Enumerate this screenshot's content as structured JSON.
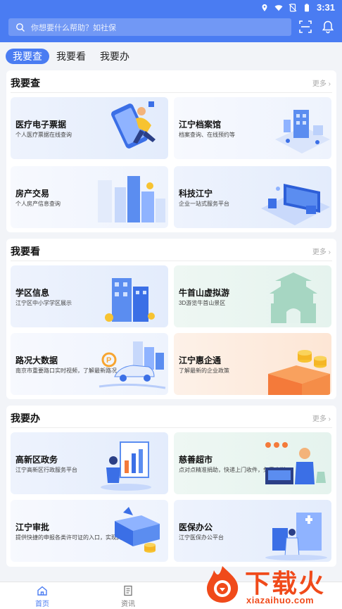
{
  "status_bar": {
    "time": "3:31",
    "icons": [
      "location-icon",
      "wifi-icon",
      "no-sim-icon",
      "battery-icon"
    ]
  },
  "header": {
    "search_placeholder": "你想要什么帮助？如社保",
    "scan_icon": "scan-icon",
    "bell_icon": "bell-icon"
  },
  "tabs": [
    {
      "label": "我要查",
      "active": true
    },
    {
      "label": "我要看",
      "active": false
    },
    {
      "label": "我要办",
      "active": false
    }
  ],
  "sections": [
    {
      "title": "我要查",
      "more": "更多",
      "cards": [
        {
          "title": "医疗电子票据",
          "subtitle": "个人医疗票据在线查询"
        },
        {
          "title": "江宁档案馆",
          "subtitle": "档案查询、在线预约等"
        },
        {
          "title": "房产交易",
          "subtitle": "个人房产信息查询"
        },
        {
          "title": "科技江宁",
          "subtitle": "企业一站式服务平台"
        }
      ]
    },
    {
      "title": "我要看",
      "more": "更多",
      "cards": [
        {
          "title": "学区信息",
          "subtitle": "江宁区中小学学区展示"
        },
        {
          "title": "牛首山虚拟游",
          "subtitle": "3D游览牛首山景区"
        },
        {
          "title": "路况大数据",
          "subtitle": "南京市重要路口实时视频，了解最新路况"
        },
        {
          "title": "江宁惠企通",
          "subtitle": "了解最新的企业政策"
        }
      ]
    },
    {
      "title": "我要办",
      "more": "更多",
      "cards": [
        {
          "title": "高新区政务",
          "subtitle": "江宁高新区行政服务平台"
        },
        {
          "title": "慈善超市",
          "subtitle": "点对点精准捐助，快递上门收件，免费寄送"
        },
        {
          "title": "江宁审批",
          "subtitle": "提供快捷的申报各类许可证的入口，实现网上申报"
        },
        {
          "title": "医保办公",
          "subtitle": "江宁医保办公平台"
        }
      ]
    }
  ],
  "bottom_nav": [
    {
      "label": "首页",
      "icon": "home-icon",
      "active": true
    },
    {
      "label": "资讯",
      "icon": "news-icon",
      "active": false
    }
  ],
  "watermark": {
    "text": "下载火",
    "url": "xiazaihuo.com"
  },
  "colors": {
    "primary": "#4a7cf2",
    "watermark": "#f04a1a"
  }
}
